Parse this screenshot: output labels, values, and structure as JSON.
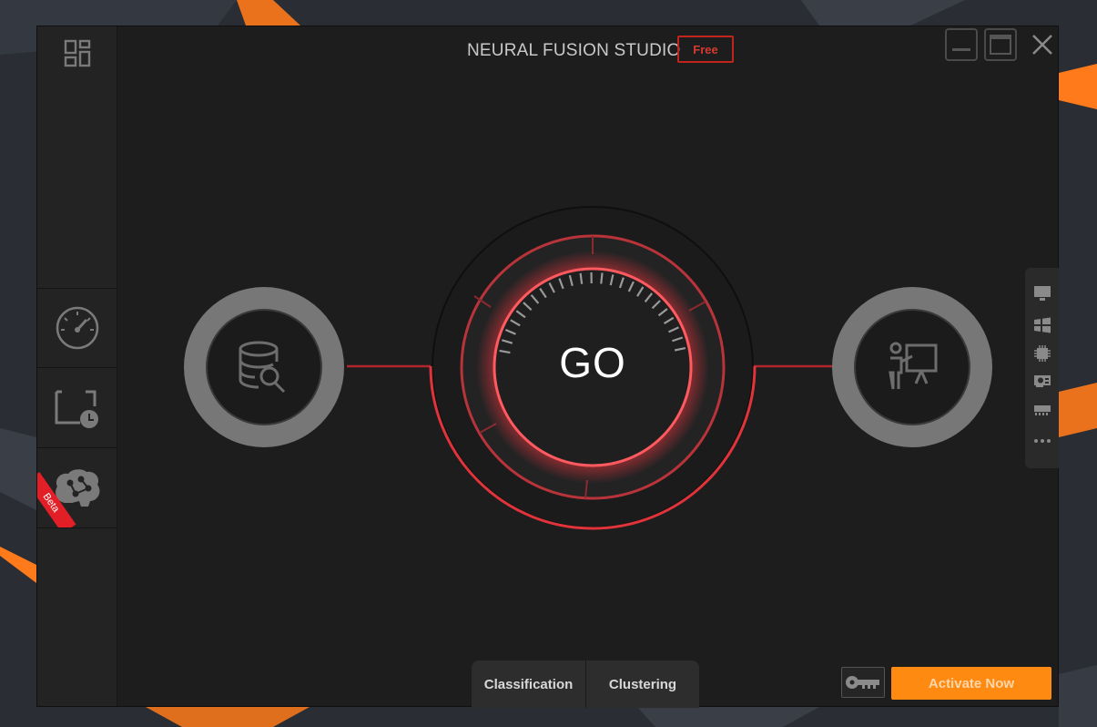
{
  "app": {
    "title": "NEURAL FUSION STUDIO",
    "edition_badge": "Free"
  },
  "sidebar": {
    "items": [
      {
        "name": "dashboard",
        "icon": "dashboard-grid-icon"
      },
      {
        "name": "benchmark",
        "icon": "speedometer-icon"
      },
      {
        "name": "scheduled-task",
        "icon": "schedule-clock-icon"
      },
      {
        "name": "ai-brain",
        "icon": "brain-circuit-icon",
        "ribbon": "Beta"
      }
    ]
  },
  "main": {
    "go_label": "GO",
    "input_node_icon": "database-search-icon",
    "output_node_icon": "presentation-icon"
  },
  "right_rail": {
    "icons": [
      "monitor-icon",
      "windows-icon",
      "cpu-chip-icon",
      "graphics-card-icon",
      "memory-icon",
      "more-icon"
    ]
  },
  "tabs": [
    {
      "label": "Classification"
    },
    {
      "label": "Clustering"
    }
  ],
  "footer": {
    "key_icon": "license-key-icon",
    "activate_label": "Activate Now"
  },
  "colors": {
    "accent_red": "#e0333a",
    "accent_orange": "#ff8a12",
    "window_bg": "#1d1d1e"
  }
}
